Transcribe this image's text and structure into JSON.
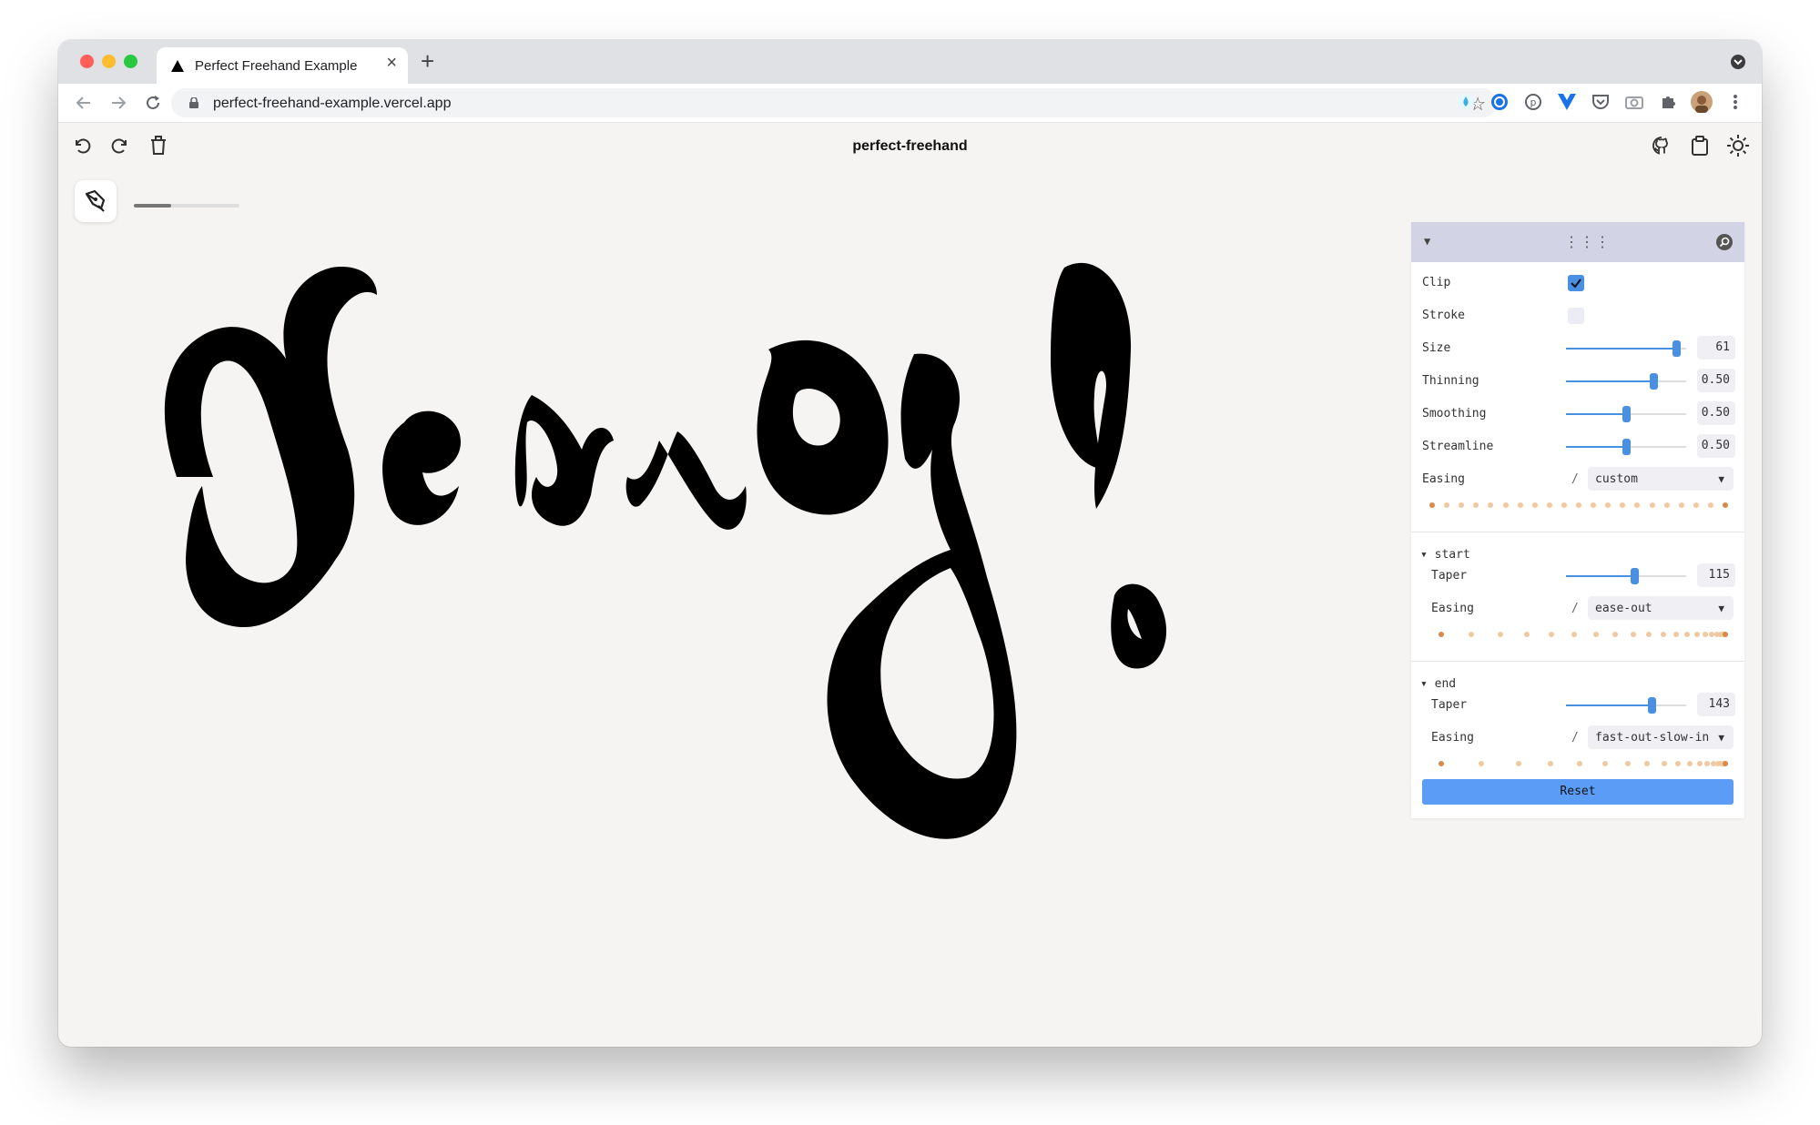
{
  "browser": {
    "tab_title": "Perfect Freehand Example",
    "url": "perfect-freehand-example.vercel.app"
  },
  "app": {
    "title": "perfect-freehand",
    "progress": 0.35
  },
  "panel": {
    "clip": {
      "label": "Clip",
      "checked": true
    },
    "stroke": {
      "label": "Stroke",
      "checked": false
    },
    "size": {
      "label": "Size",
      "value": "61",
      "fraction": 0.92
    },
    "thinning": {
      "label": "Thinning",
      "value": "0.50",
      "fraction": 0.73
    },
    "smoothing": {
      "label": "Smoothing",
      "value": "0.50",
      "fraction": 0.5
    },
    "streamline": {
      "label": "Streamline",
      "value": "0.50",
      "fraction": 0.5
    },
    "easing": {
      "label": "Easing",
      "value": "custom"
    },
    "start": {
      "title": "start",
      "taper_label": "Taper",
      "taper_value": "115",
      "taper_fraction": 0.57,
      "easing_label": "Easing",
      "easing_value": "ease-out"
    },
    "end": {
      "title": "end",
      "taper_label": "Taper",
      "taper_value": "143",
      "taper_fraction": 0.71,
      "easing_label": "Easing",
      "easing_value": "fast-out-slow-in"
    },
    "reset_label": "Reset"
  },
  "colors": {
    "accent": "#4a90e2",
    "dot": "#f0c9a0",
    "dot_end": "#d98a4a",
    "ink": "#000000"
  }
}
